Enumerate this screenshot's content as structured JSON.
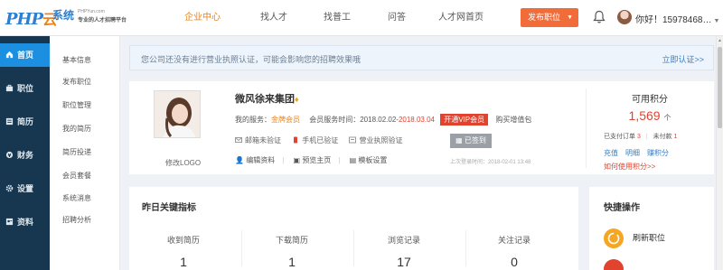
{
  "header": {
    "logo_mark": "PHP",
    "logo_mark_cn": "云",
    "logo_text": "系统",
    "logo_sub": "PHPYun.com",
    "logo_slogan": "专业的人才招聘平台",
    "nav": [
      {
        "label": "企业中心",
        "active": true
      },
      {
        "label": "找人才",
        "active": false
      },
      {
        "label": "找普工",
        "active": false
      },
      {
        "label": "问答",
        "active": false
      },
      {
        "label": "人才网首页",
        "active": false
      }
    ],
    "publish_label": "发布职位",
    "greeting": "你好！15978468…"
  },
  "sidebar_main": [
    {
      "label": "首页",
      "icon": "home-icon",
      "active": true
    },
    {
      "label": "职位",
      "icon": "briefcase-icon",
      "active": false
    },
    {
      "label": "简历",
      "icon": "resume-icon",
      "active": false
    },
    {
      "label": "财务",
      "icon": "finance-icon",
      "active": false
    },
    {
      "label": "设置",
      "icon": "gear-icon",
      "active": false
    },
    {
      "label": "资料",
      "icon": "profile-icon",
      "active": false
    }
  ],
  "sidebar_sub": [
    "基本信息",
    "发布职位",
    "职位管理",
    "我的简历",
    "简历投递",
    "会员套餐",
    "系统消息",
    "招聘分析"
  ],
  "notice": {
    "text": "您公司还没有进行营业执照认证，可能会影响您的招聘效果哦",
    "link": "立即认证>>"
  },
  "profile": {
    "logo_caption": "修改LOGO",
    "company": "微风徐来集团",
    "service_prefix": "我的服务：",
    "service_level": "金牌会员",
    "service_time_label": "会员服务时间：",
    "service_start": "2018.02.02-",
    "service_end": "2018.03.04",
    "open_label": "开通VIP会员",
    "buy_label": "购买增值包",
    "verify": [
      "邮箱未验证",
      "手机已验证",
      "营业执照验证"
    ],
    "signed_label": "已签到",
    "links": [
      "编辑资料",
      "预览主页",
      "模板设置"
    ],
    "last_login": "上次登录时间：2018-02-01 13:48"
  },
  "points": {
    "title": "可用积分",
    "value": "1,569",
    "unit": "个",
    "paid_label": "已支付订单",
    "paid_count": "3",
    "unpaid_label": "未付款",
    "unpaid_count": "1",
    "actions": [
      "充值",
      "明细",
      "赚积分"
    ],
    "how": "如何使用积分>>"
  },
  "stats": {
    "title": "昨日关键指标",
    "items": [
      {
        "label": "收到简历",
        "value": "1"
      },
      {
        "label": "下载简历",
        "value": "1"
      },
      {
        "label": "浏览记录",
        "value": "17"
      },
      {
        "label": "关注记录",
        "value": "0"
      }
    ]
  },
  "quick": {
    "title": "快捷操作",
    "items": [
      {
        "label": "刷新职位",
        "color": "#f5a623"
      },
      {
        "label": "",
        "color": "#e2432e"
      }
    ]
  },
  "colors": {
    "accent": "#e8831e",
    "sidebar_dark": "#16374f",
    "sidebar_active": "#1d8fe1",
    "danger": "#e2432e",
    "link": "#3a7fc4"
  }
}
